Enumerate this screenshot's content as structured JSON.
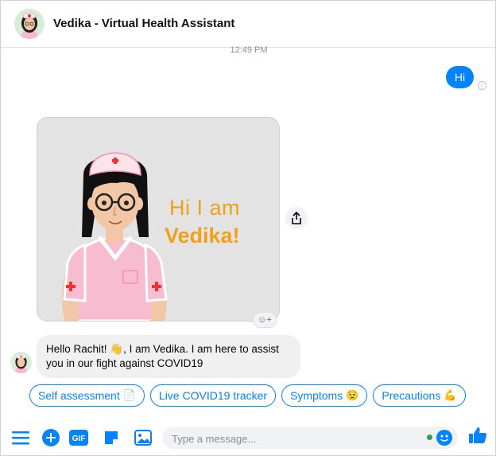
{
  "header": {
    "title": "Vedika - Virtual Health Assistant",
    "avatar_icon": "nurse-avatar"
  },
  "conversation": {
    "timestamp": "12:49 PM",
    "outgoing_message": "Hi",
    "card": {
      "line1": "Hi I am",
      "line2": "Vedika!",
      "image": "nurse-illustration"
    },
    "incoming_message": "Hello Rachit! 👋, I am Vedika. I am here to assist you in our fight against COVID19"
  },
  "quick_replies": [
    {
      "label": "Self assessment",
      "emoji": "📄"
    },
    {
      "label": "Live COVID19 tracker",
      "emoji": ""
    },
    {
      "label": "Symptoms",
      "emoji": "😟"
    },
    {
      "label": "Precautions",
      "emoji": "💪"
    }
  ],
  "composer": {
    "placeholder": "Type a message...",
    "icons": [
      "menu-icon",
      "plus-icon",
      "gif-icon",
      "sticker-icon",
      "image-icon",
      "emoji-icon",
      "like-icon"
    ]
  },
  "colors": {
    "accent": "#0084ff",
    "card_text": "#f0a01a",
    "online": "#31a24c"
  }
}
